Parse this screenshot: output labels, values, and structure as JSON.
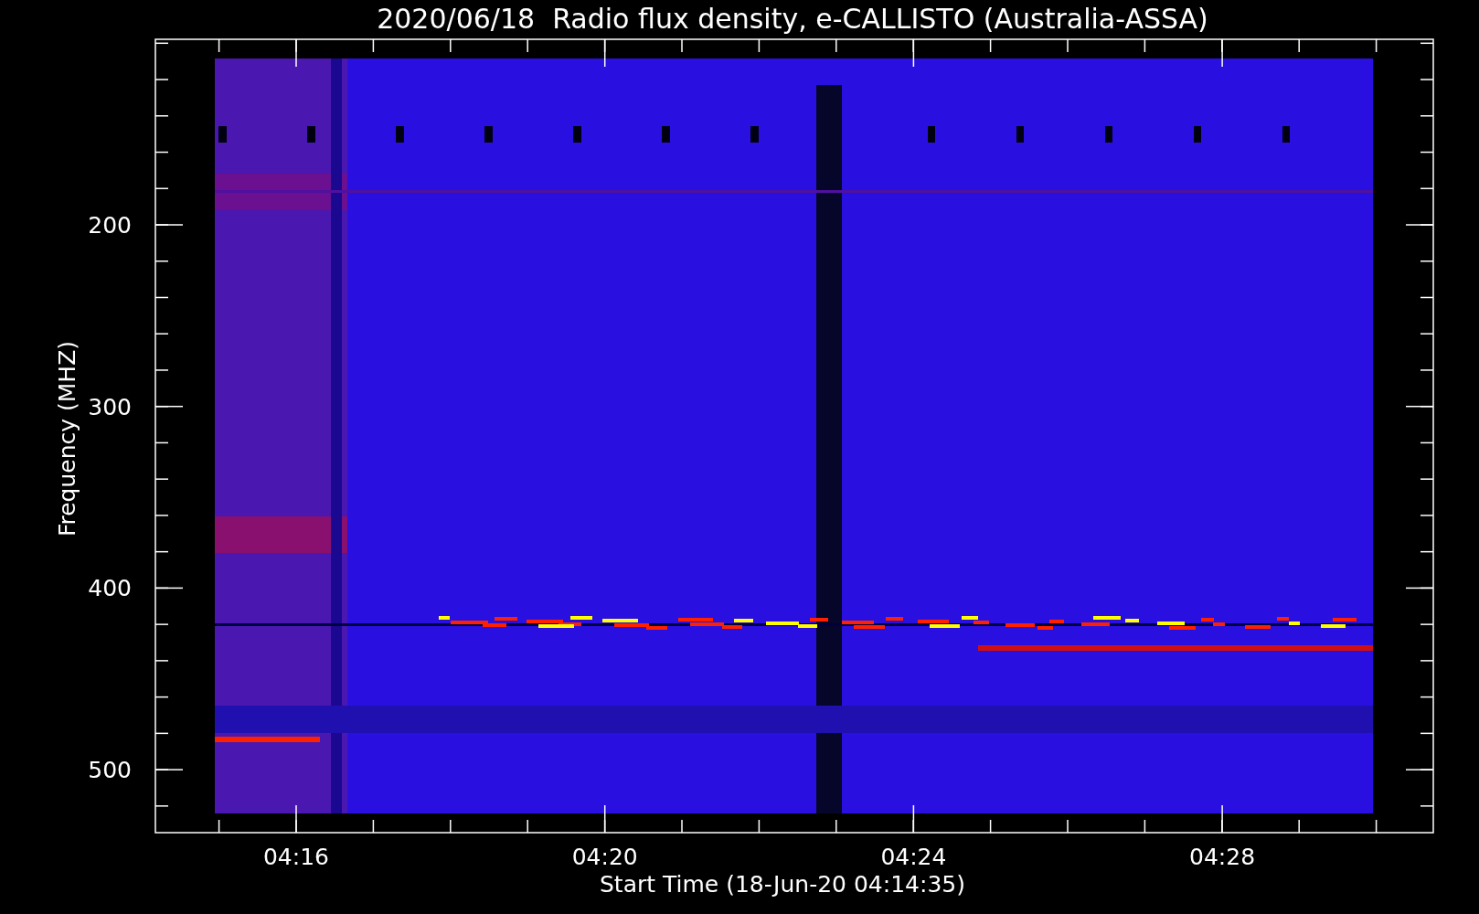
{
  "plot": {
    "title": "2020/06/18  Radio flux density, e-CALLISTO (Australia-ASSA)",
    "y_axis": {
      "label": "Frequency (MHZ)",
      "ticks": [
        "200",
        "300",
        "400",
        "500"
      ]
    },
    "x_axis": {
      "label": "Start Time (18-Jun-20 04:14:35)",
      "ticks": [
        "04:16",
        "04:20",
        "04:24",
        "04:28"
      ]
    }
  }
}
